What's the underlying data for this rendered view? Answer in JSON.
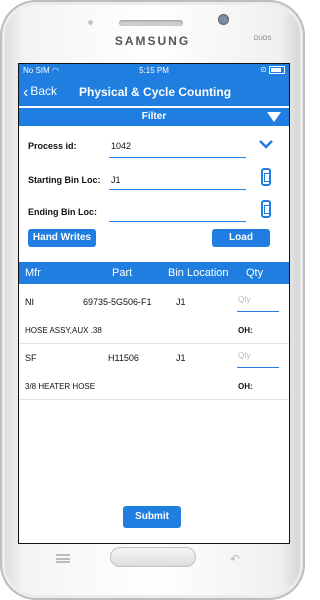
{
  "device": {
    "brand": "SAMSUNG",
    "badge": "DUOS"
  },
  "status": {
    "carrier": "No SIM",
    "time": "5:15 PM"
  },
  "nav": {
    "back_label": "Back",
    "title": "Physical & Cycle Counting"
  },
  "filter": {
    "label": "Filter"
  },
  "form": {
    "process_id_label": "Process id:",
    "process_id_value": "1042",
    "start_bin_label": "Starting Bin Loc:",
    "start_bin_value": "J1",
    "end_bin_label": "Ending Bin Loc:",
    "end_bin_value": ""
  },
  "buttons": {
    "hand_writes": "Hand Writes",
    "load": "Load",
    "submit": "Submit"
  },
  "table": {
    "headers": [
      "Mfr",
      "Part",
      "Bin Location",
      "Qty"
    ],
    "rows": [
      {
        "mfr": "NI",
        "part": "69735-5G506-F1",
        "bin": "J1",
        "qty_placeholder": "Qty",
        "description": "HOSE ASSY,AUX .38",
        "oh_label": "OH:"
      },
      {
        "mfr": "SF",
        "part": "H11506",
        "bin": "J1",
        "qty_placeholder": "Qty",
        "description": "3/8 HEATER HOSE",
        "oh_label": "OH:"
      }
    ]
  },
  "colors": {
    "accent": "#1f7ee0"
  }
}
